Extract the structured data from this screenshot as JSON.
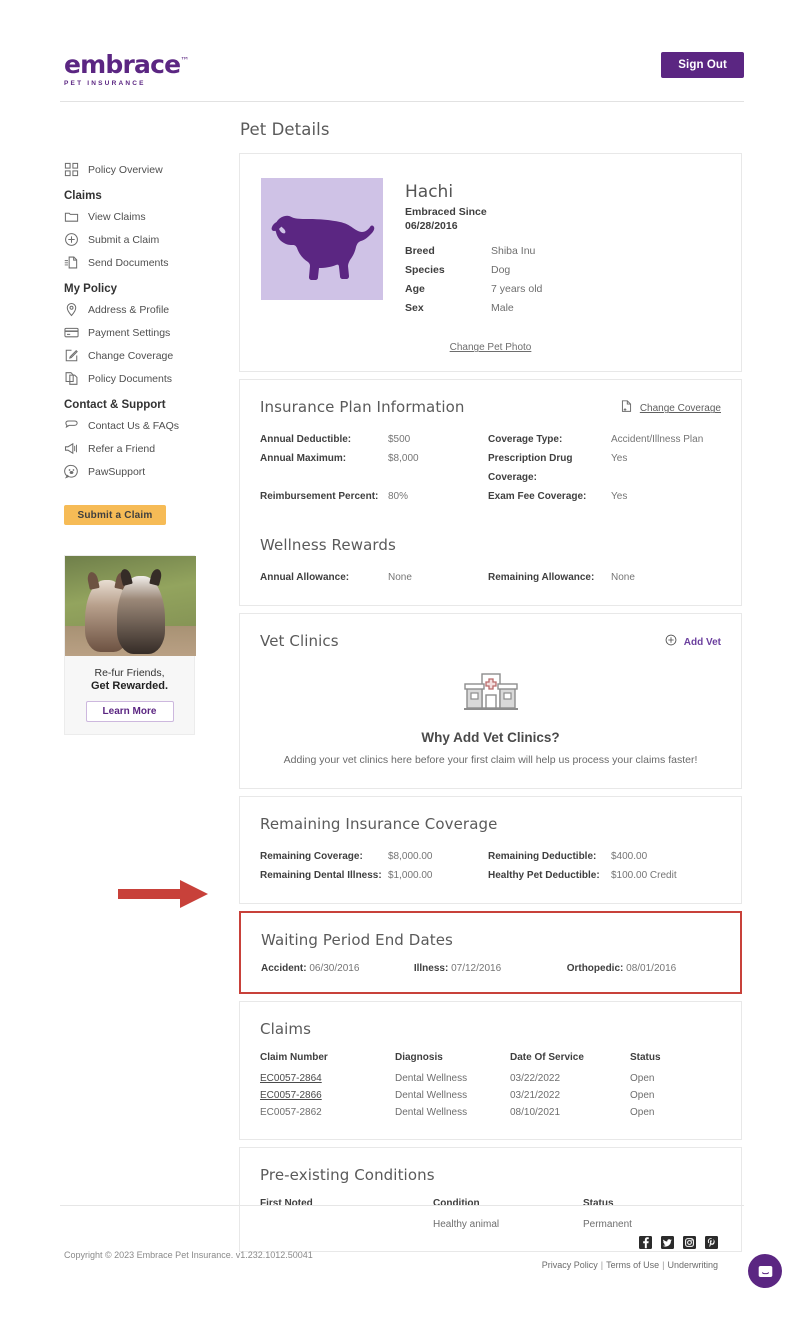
{
  "brand": {
    "logo_word": "embrace",
    "logo_tm": "™",
    "logo_sub": "PET INSURANCE",
    "purple": "#5b2682",
    "accent_yellow": "#f6bb56",
    "annotation_red": "#c8413a"
  },
  "header": {
    "sign_out": "Sign Out"
  },
  "sidebar": {
    "items": [
      {
        "label": "Policy Overview",
        "icon": "grid-icon"
      }
    ],
    "groups": [
      {
        "title": "Claims",
        "items": [
          {
            "label": "View Claims",
            "icon": "folder-icon"
          },
          {
            "label": "Submit a Claim",
            "icon": "plus-circle-icon"
          },
          {
            "label": "Send Documents",
            "icon": "send-document-icon"
          }
        ]
      },
      {
        "title": "My Policy",
        "items": [
          {
            "label": "Address & Profile",
            "icon": "location-pin-icon"
          },
          {
            "label": "Payment Settings",
            "icon": "credit-card-icon"
          },
          {
            "label": "Change Coverage",
            "icon": "edit-square-icon"
          },
          {
            "label": "Policy Documents",
            "icon": "copy-documents-icon"
          }
        ]
      },
      {
        "title": "Contact & Support",
        "items": [
          {
            "label": "Contact Us & FAQs",
            "icon": "chat-bubble-icon"
          },
          {
            "label": "Refer a Friend",
            "icon": "megaphone-icon"
          },
          {
            "label": "PawSupport",
            "icon": "paw-support-icon"
          }
        ]
      }
    ],
    "cta_button": "Submit a Claim",
    "promo": {
      "line1": "Re-fur Friends,",
      "line2": "Get Rewarded.",
      "button": "Learn More"
    }
  },
  "main": {
    "page_title": "Pet Details",
    "pet": {
      "name": "Hachi",
      "embraced_since_label": "Embraced Since",
      "embraced_since_date": "06/28/2016",
      "attributes": [
        {
          "key": "Breed",
          "value": "Shiba Inu"
        },
        {
          "key": "Species",
          "value": "Dog"
        },
        {
          "key": "Age",
          "value": "7 years old"
        },
        {
          "key": "Sex",
          "value": "Male"
        }
      ],
      "change_photo": "Change Pet Photo"
    },
    "insurance_plan": {
      "title": "Insurance Plan Information",
      "change_coverage_link": "Change Coverage",
      "rows": [
        {
          "k1": "Annual Deductible:",
          "v1": "$500",
          "k2": "Coverage Type:",
          "v2": "Accident/Illness Plan"
        },
        {
          "k1": "Annual Maximum:",
          "v1": "$8,000",
          "k2": "Prescription Drug Coverage:",
          "v2": "Yes"
        },
        {
          "k1": "Reimbursement Percent:",
          "v1": "80%",
          "k2": "Exam Fee Coverage:",
          "v2": "Yes"
        }
      ]
    },
    "wellness": {
      "title": "Wellness Rewards",
      "rows": [
        {
          "k1": "Annual Allowance:",
          "v1": "None",
          "k2": "Remaining Allowance:",
          "v2": "None"
        }
      ]
    },
    "vet_clinics": {
      "title": "Vet Clinics",
      "add_vet_link": "Add Vet",
      "empty_title": "Why Add Vet Clinics?",
      "empty_desc": "Adding your vet clinics here before your first claim will help us process your claims faster!"
    },
    "remaining_coverage": {
      "title": "Remaining Insurance Coverage",
      "rows": [
        {
          "k1": "Remaining Coverage:",
          "v1": "$8,000.00",
          "k2": "Remaining Deductible:",
          "v2": "$400.00"
        },
        {
          "k1": "Remaining Dental Illness:",
          "v1": "$1,000.00",
          "k2": "Healthy Pet Deductible:",
          "v2": "$100.00 Credit"
        }
      ]
    },
    "waiting_periods": {
      "title": "Waiting Period End Dates",
      "items": [
        {
          "key": "Accident:",
          "value": "06/30/2016"
        },
        {
          "key": "Illness:",
          "value": "07/12/2016"
        },
        {
          "key": "Orthopedic:",
          "value": "08/01/2016"
        }
      ]
    },
    "claims": {
      "title": "Claims",
      "headers": [
        "Claim Number",
        "Diagnosis",
        "Date Of Service",
        "Status"
      ],
      "rows": [
        {
          "number": "EC0057-2864",
          "linked": true,
          "diagnosis": "Dental Wellness",
          "date": "03/22/2022",
          "status": "Open"
        },
        {
          "number": "EC0057-2866",
          "linked": true,
          "diagnosis": "Dental Wellness",
          "date": "03/21/2022",
          "status": "Open"
        },
        {
          "number": "EC0057-2862",
          "linked": false,
          "diagnosis": "Dental Wellness",
          "date": "08/10/2021",
          "status": "Open"
        }
      ]
    },
    "preexisting": {
      "title": "Pre-existing Conditions",
      "headers": [
        "First Noted",
        "Condition",
        "Status"
      ],
      "rows": [
        {
          "first_noted": "",
          "condition": "Healthy animal",
          "status": "Permanent"
        }
      ]
    }
  },
  "footer": {
    "copyright": "Copyright © 2023   Embrace Pet Insurance. v1.232.1012.50041",
    "social": [
      {
        "name": "facebook-icon",
        "glyph": "f"
      },
      {
        "name": "twitter-icon",
        "glyph": "🐦"
      },
      {
        "name": "instagram-icon",
        "glyph": "◙"
      },
      {
        "name": "pinterest-icon",
        "glyph": "P"
      }
    ],
    "legal": [
      "Privacy Policy",
      "Terms of Use",
      "Underwriting"
    ],
    "separator": "|"
  }
}
